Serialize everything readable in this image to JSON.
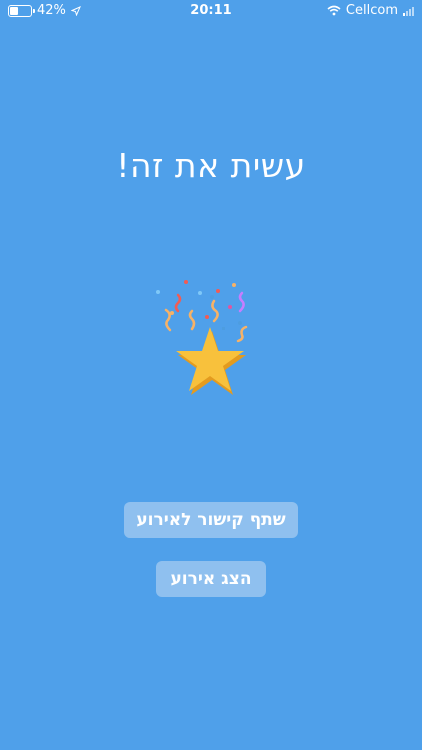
{
  "status_bar": {
    "battery": "42%",
    "battery_level": 0.42,
    "time": "20:11",
    "carrier": "Cellcom"
  },
  "main": {
    "title": "עשית את זה!",
    "share_button": "שתף קישור לאירוע",
    "show_button": "הצג אירוע"
  },
  "icons": [
    "battery-icon",
    "location-arrow-icon",
    "wifi-icon",
    "signal-icon",
    "star-confetti-icon"
  ],
  "colors": {
    "background": "#4fa0ea",
    "button": "#8fc0ef",
    "star": "#f8c13c"
  }
}
